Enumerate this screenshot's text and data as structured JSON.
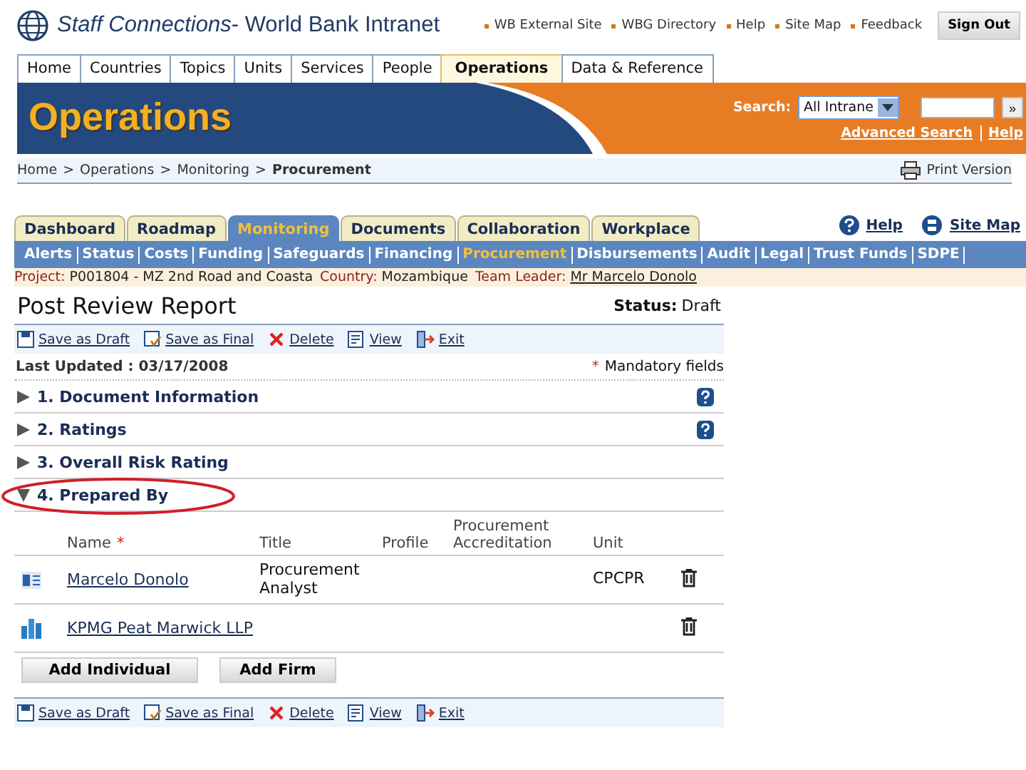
{
  "header": {
    "title_italic": "Staff Connections",
    "title_rest": "- World Bank Intranet",
    "links": [
      "WB External Site",
      "WBG Directory",
      "Help",
      "Site Map",
      "Feedback"
    ],
    "sign_out": "Sign Out"
  },
  "top_tabs": [
    {
      "label": "Home",
      "selected": false
    },
    {
      "label": "Countries",
      "selected": false
    },
    {
      "label": "Topics",
      "selected": false
    },
    {
      "label": "Units",
      "selected": false
    },
    {
      "label": "Services",
      "selected": false
    },
    {
      "label": "People",
      "selected": false
    },
    {
      "label": "Operations",
      "selected": true
    },
    {
      "label": "Data & Reference",
      "selected": false
    }
  ],
  "banner": {
    "title": "Operations",
    "search_label": "Search:",
    "search_scope": "All Intrane",
    "go": "»",
    "advanced_search": "Advanced Search",
    "help": "Help"
  },
  "breadcrumb": {
    "items": [
      "Home",
      "Operations",
      "Monitoring"
    ],
    "current": "Procurement",
    "separator": ">",
    "print": "Print Version"
  },
  "section_tabs": [
    {
      "label": "Dashboard",
      "selected": false
    },
    {
      "label": "Roadmap",
      "selected": false
    },
    {
      "label": "Monitoring",
      "selected": true
    },
    {
      "label": "Documents",
      "selected": false
    },
    {
      "label": "Collaboration",
      "selected": false
    },
    {
      "label": "Workplace",
      "selected": false
    }
  ],
  "section_links": [
    {
      "kind": "help",
      "label": "Help"
    },
    {
      "kind": "sitemap",
      "label": "Site Map"
    }
  ],
  "sub_nav": [
    {
      "label": "Alerts",
      "selected": false
    },
    {
      "label": "Status",
      "selected": false
    },
    {
      "label": "Costs",
      "selected": false
    },
    {
      "label": "Funding",
      "selected": false
    },
    {
      "label": "Safeguards",
      "selected": false
    },
    {
      "label": "Financing",
      "selected": false
    },
    {
      "label": "Procurement",
      "selected": true
    },
    {
      "label": "Disbursements",
      "selected": false
    },
    {
      "label": "Audit",
      "selected": false
    },
    {
      "label": "Legal",
      "selected": false
    },
    {
      "label": "Trust Funds",
      "selected": false
    },
    {
      "label": "SDPE",
      "selected": false
    }
  ],
  "project_bar": {
    "project_label": "Project:",
    "project": "P001804 - MZ 2nd Road and Coasta",
    "country_label": "Country:",
    "country": "Mozambique",
    "leader_label": "Team Leader:",
    "leader": "Mr Marcelo Donolo"
  },
  "report": {
    "title": "Post Review Report",
    "status_label": "Status:",
    "status": "Draft",
    "last_updated": "Last Updated : 03/17/2008",
    "mandatory_mark": "*",
    "mandatory": "Mandatory fields"
  },
  "toolbar_top": [
    {
      "kind": "save",
      "label": "Save as Draft"
    },
    {
      "kind": "final",
      "label": "Save as Final"
    },
    {
      "kind": "delete",
      "label": "Delete"
    },
    {
      "kind": "view",
      "label": "View"
    },
    {
      "kind": "exit",
      "label": "Exit"
    }
  ],
  "sections": [
    {
      "label": "1. Document Information",
      "expanded": false,
      "help": true
    },
    {
      "label": "2. Ratings",
      "expanded": false,
      "help": true
    },
    {
      "label": "3. Overall Risk Rating",
      "expanded": false,
      "help": false
    },
    {
      "label": "4. Prepared By",
      "expanded": true,
      "help": false,
      "highlighted": true
    }
  ],
  "table": {
    "columns": [
      "Name",
      "Title",
      "Profile",
      "Procurement Accreditation",
      "Unit"
    ],
    "required_mark": "*",
    "rows": [
      {
        "kind": "person",
        "name": "Marcelo Donolo",
        "title": "Procurement Analyst",
        "profile": "",
        "accreditation": "",
        "unit": "CPCPR"
      },
      {
        "kind": "firm",
        "name": "KPMG Peat Marwick LLP",
        "title": "",
        "profile": "",
        "accreditation": "",
        "unit": ""
      }
    ]
  },
  "buttons": [
    "Add Individual",
    "Add Firm"
  ],
  "toolbar_bottom": [
    {
      "kind": "save",
      "label": "Save as Draft"
    },
    {
      "kind": "final",
      "label": "Save as Final"
    },
    {
      "kind": "delete",
      "label": "Delete"
    },
    {
      "kind": "view",
      "label": "View"
    },
    {
      "kind": "exit",
      "label": "Exit"
    }
  ]
}
